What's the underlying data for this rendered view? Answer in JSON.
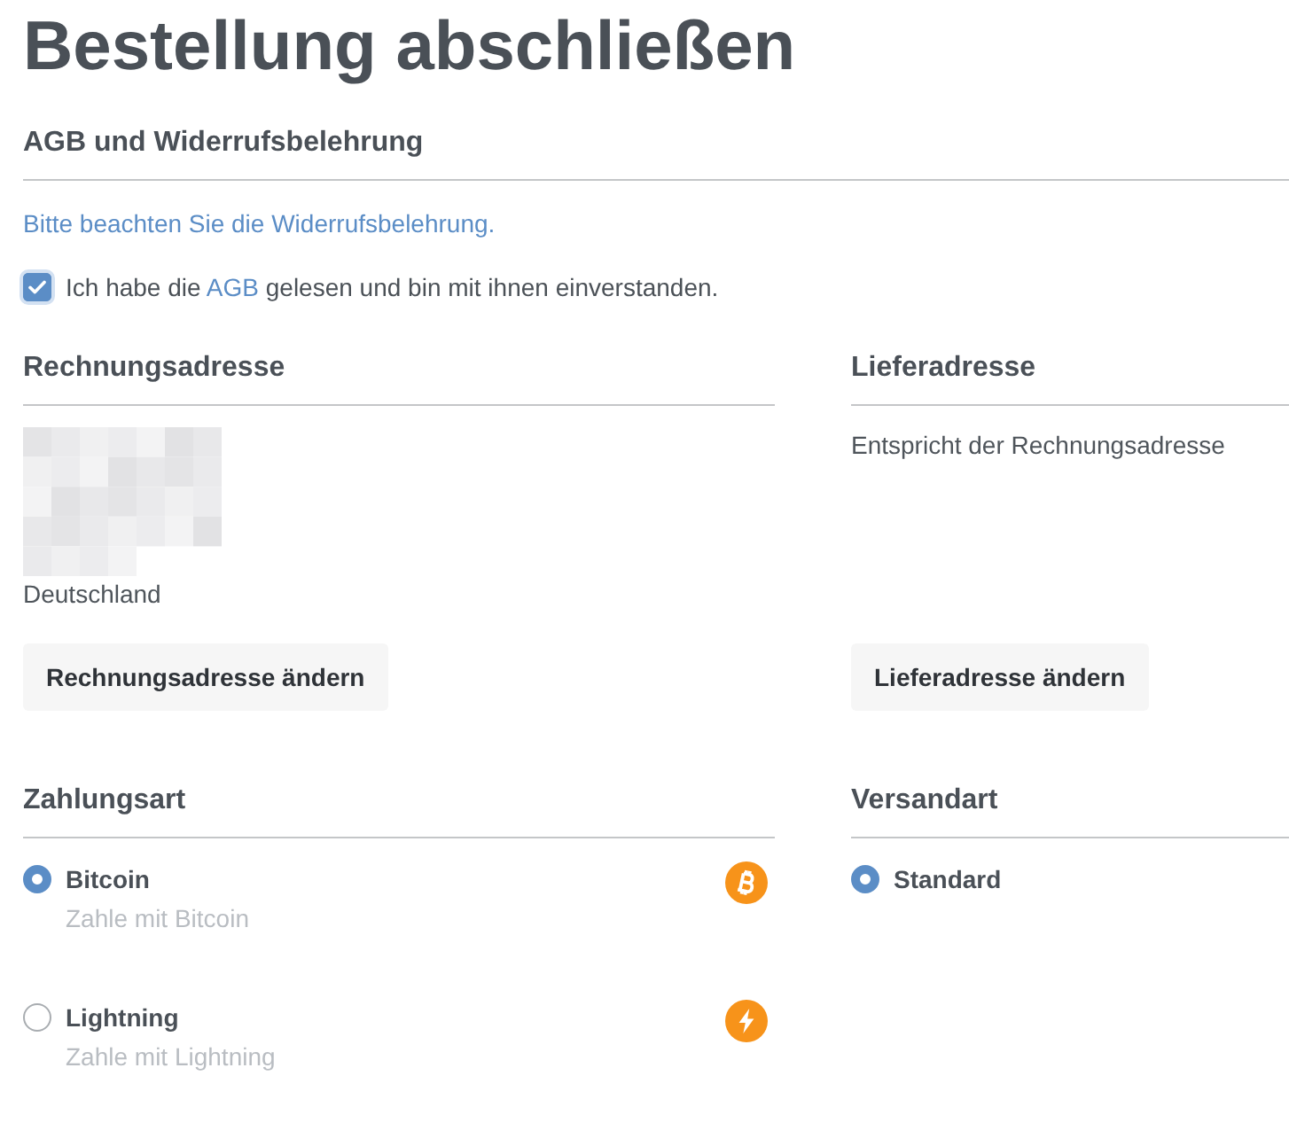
{
  "title": "Bestellung abschließen",
  "terms": {
    "heading": "AGB und Widerrufsbelehrung",
    "link": "Bitte beachten Sie die Widerrufsbelehrung.",
    "consent": {
      "checked": true,
      "before": "Ich habe die ",
      "link": "AGB",
      "after": " gelesen und bin mit ihnen einverstanden."
    }
  },
  "billing_address": {
    "heading": "Rechnungsadresse",
    "lines": [
      "Deutschland"
    ],
    "button": "Rechnungsadresse ändern"
  },
  "delivery_address": {
    "heading": "Lieferadresse",
    "note": "Entspricht der Rechnungsadresse",
    "button": "Lieferadresse ändern"
  },
  "payment": {
    "heading": "Zahlungsart",
    "options": [
      {
        "kind": "bitcoin",
        "label": "Bitcoin",
        "description": "Zahle mit Bitcoin",
        "selected": true
      },
      {
        "kind": "lightning",
        "label": "Lightning",
        "description": "Zahle mit Lightning",
        "selected": false
      }
    ]
  },
  "shipping": {
    "heading": "Versandart",
    "options": [
      {
        "label": "Standard",
        "selected": true
      }
    ]
  }
}
